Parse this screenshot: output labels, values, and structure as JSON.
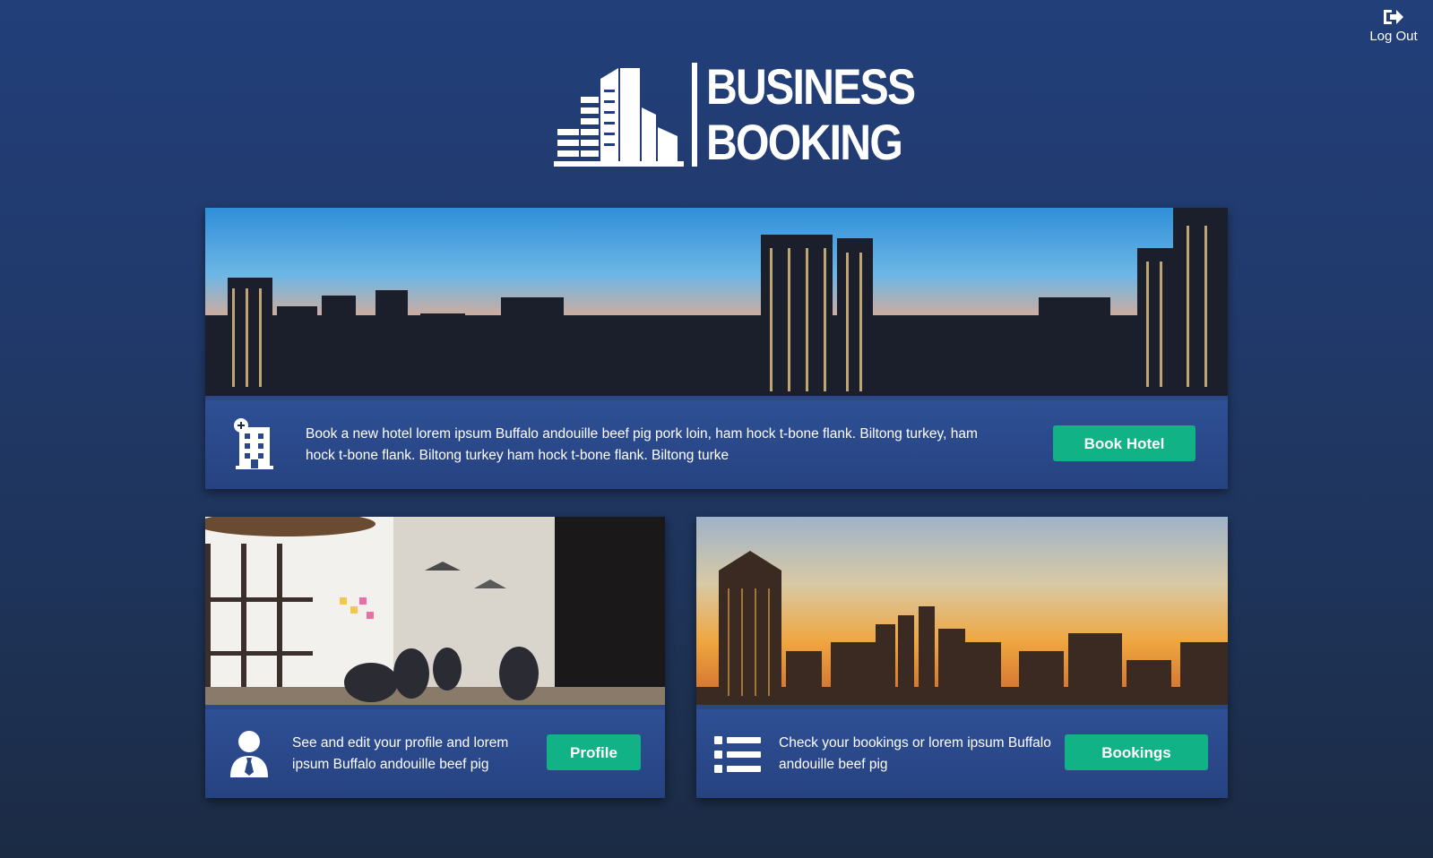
{
  "header": {
    "logout_label": "Log Out",
    "logout_icon": "sign-out-icon"
  },
  "logo": {
    "line1": "BUSINESS",
    "line2": "BOOKING",
    "icon": "city-buildings-icon"
  },
  "cards": {
    "hotel": {
      "icon": "hotel-add-icon",
      "text": "Book a new hotel lorem ipsum Buffalo andouille beef pig pork loin, ham hock t-bone flank. Biltong turkey, ham hock t-bone flank. Biltong turkey ham hock t-bone flank. Biltong turke",
      "button_label": "Book Hotel",
      "image": "city skyline at sunset"
    },
    "profile": {
      "icon": "user-tie-icon",
      "text": "See and edit your profile and lorem ipsum Buffalo andouille beef pig",
      "button_label": "Profile",
      "image": "people working in office"
    },
    "bookings": {
      "icon": "list-icon",
      "text": "Check your bookings or lorem ipsum Buffalo andouille beef pig",
      "button_label": "Bookings",
      "image": "city skyline golden sky"
    }
  },
  "colors": {
    "background_top": "#223f7a",
    "background_bottom": "#1b2b44",
    "card_body": "#2a4887",
    "button": "#11b285",
    "text": "#ffffff"
  }
}
